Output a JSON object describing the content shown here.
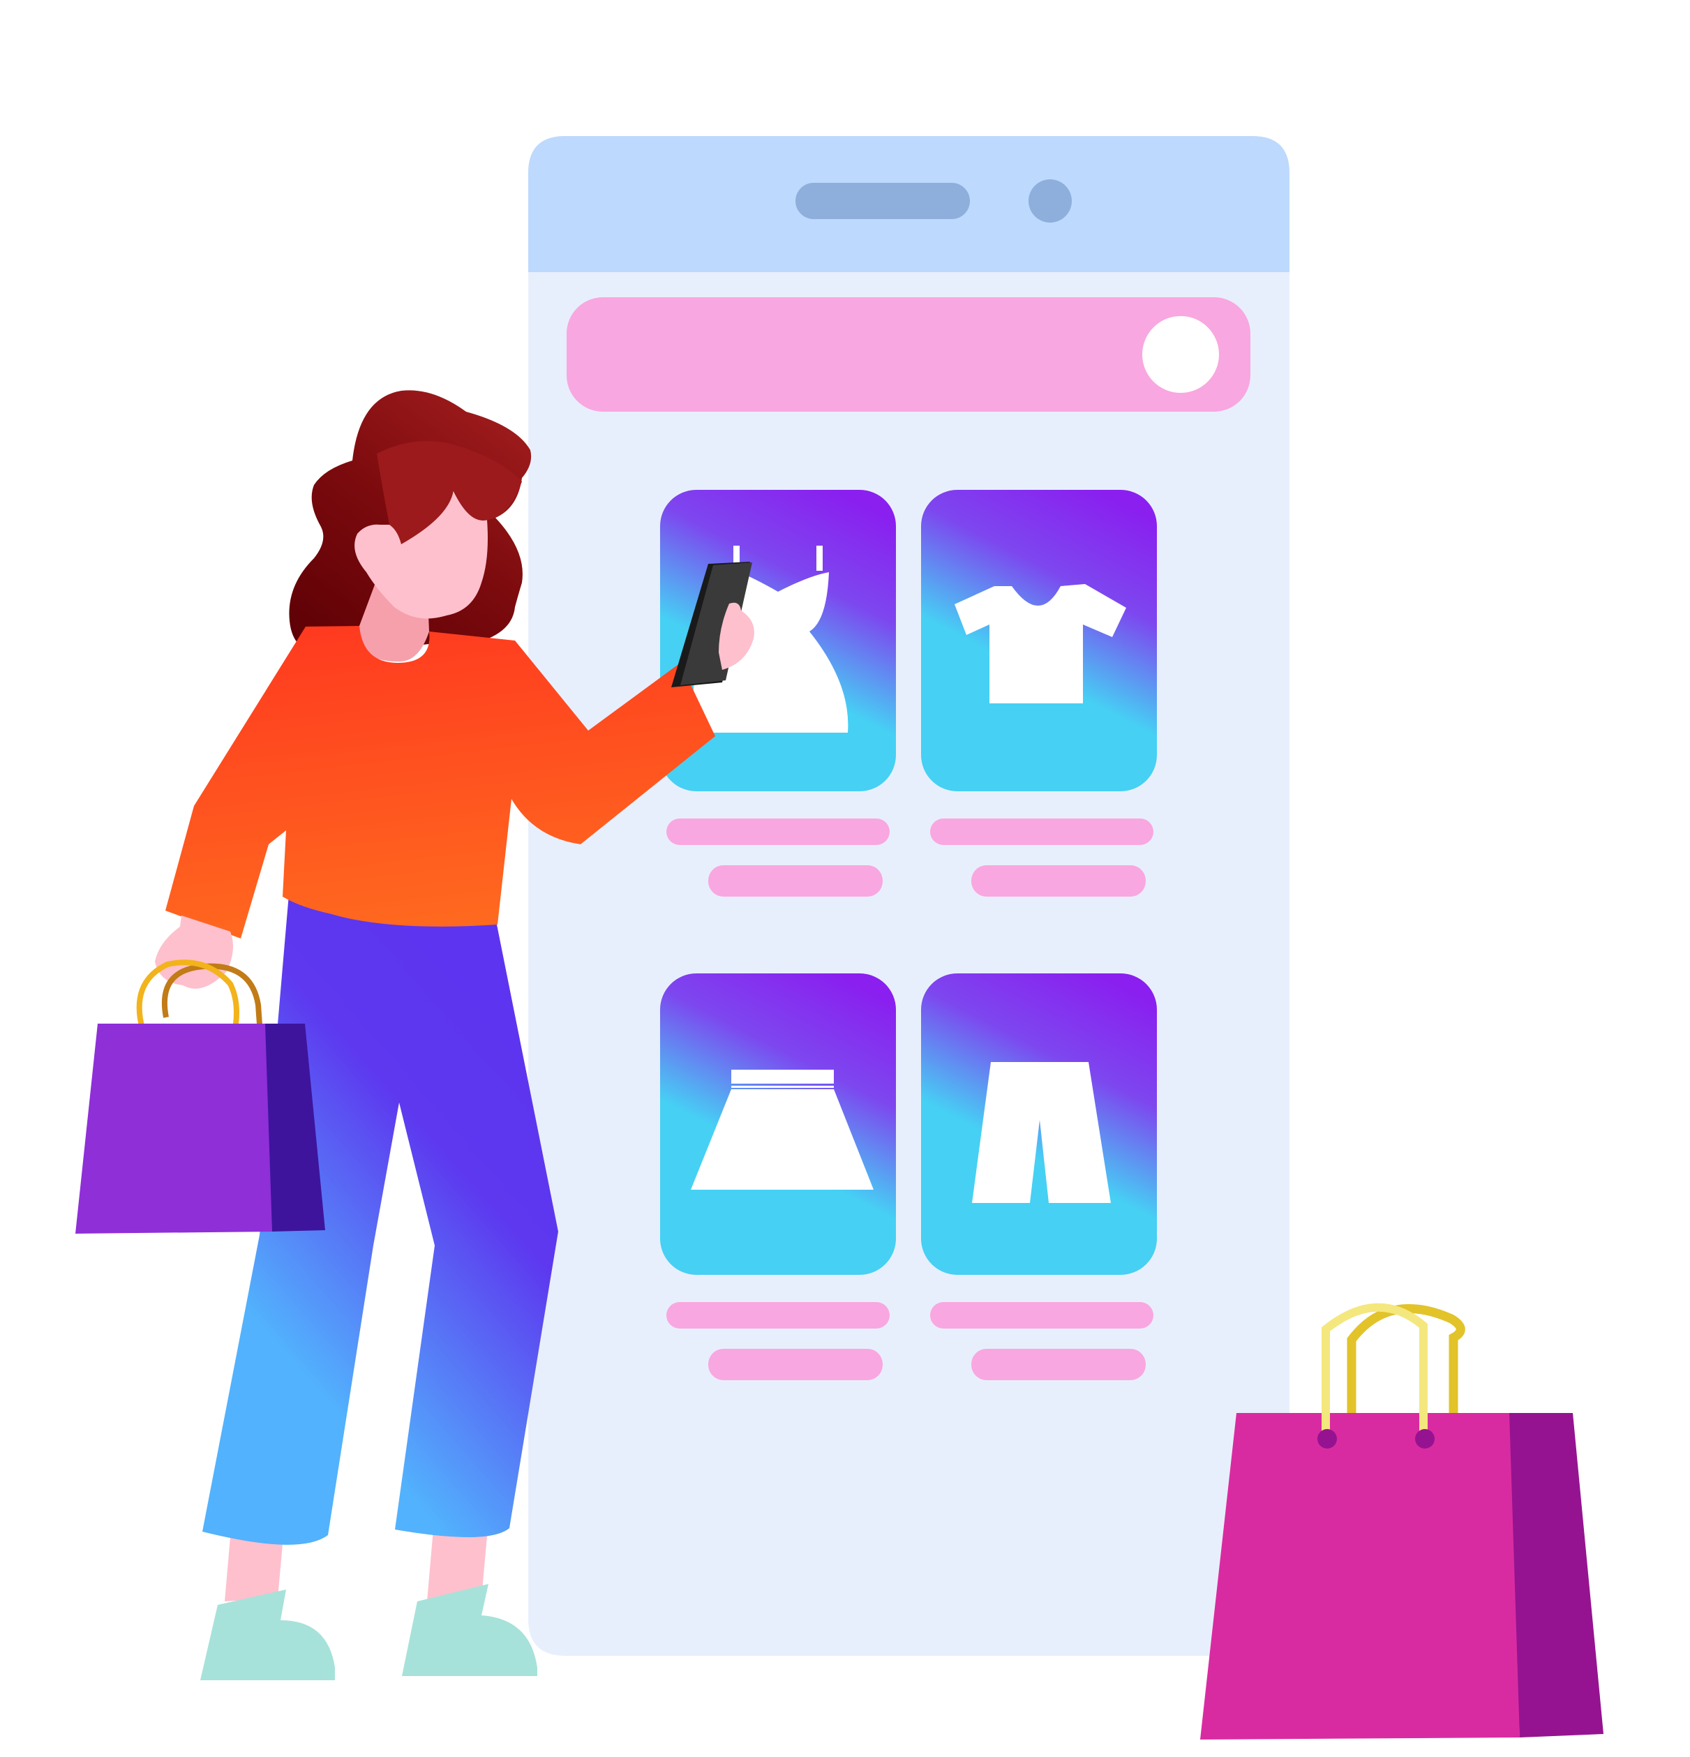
{
  "colors": {
    "background": "#ffffff",
    "phone_body": "#e8effc",
    "phone_header": "#bdd9fd",
    "speaker": "#8eafdb",
    "search_bar": "#f9a7e0",
    "search_knob": "#ffffff",
    "text_line": "#f9a7e0",
    "card_top": "#8a1fef",
    "card_bottom": "#46d0f4",
    "garment": "#ffffff",
    "hair_dark": "#5b0005",
    "hair_light": "#9c1a1b",
    "skin": "#fec0cd",
    "neck": "#f6a0ac",
    "shirt_top": "#ff3a1f",
    "shirt_bottom": "#ff6b1f",
    "pants_top": "#5d34ef",
    "pants_bottom": "#52b2fd",
    "shoes": "#a6e2d9",
    "phone_handheld": "#333333",
    "purple_bag": "#8e2fd8",
    "purple_bag_side": "#3e149d",
    "magenta_bag": "#d92ba1",
    "magenta_bag_side": "#951390",
    "bag_handle_gold": "#e2c32a",
    "bag_handle_light": "#f4e77e"
  },
  "icons": {
    "card_1": "dress-icon",
    "card_2": "tshirt-icon",
    "card_3": "skirt-icon",
    "card_4": "pants-icon"
  }
}
